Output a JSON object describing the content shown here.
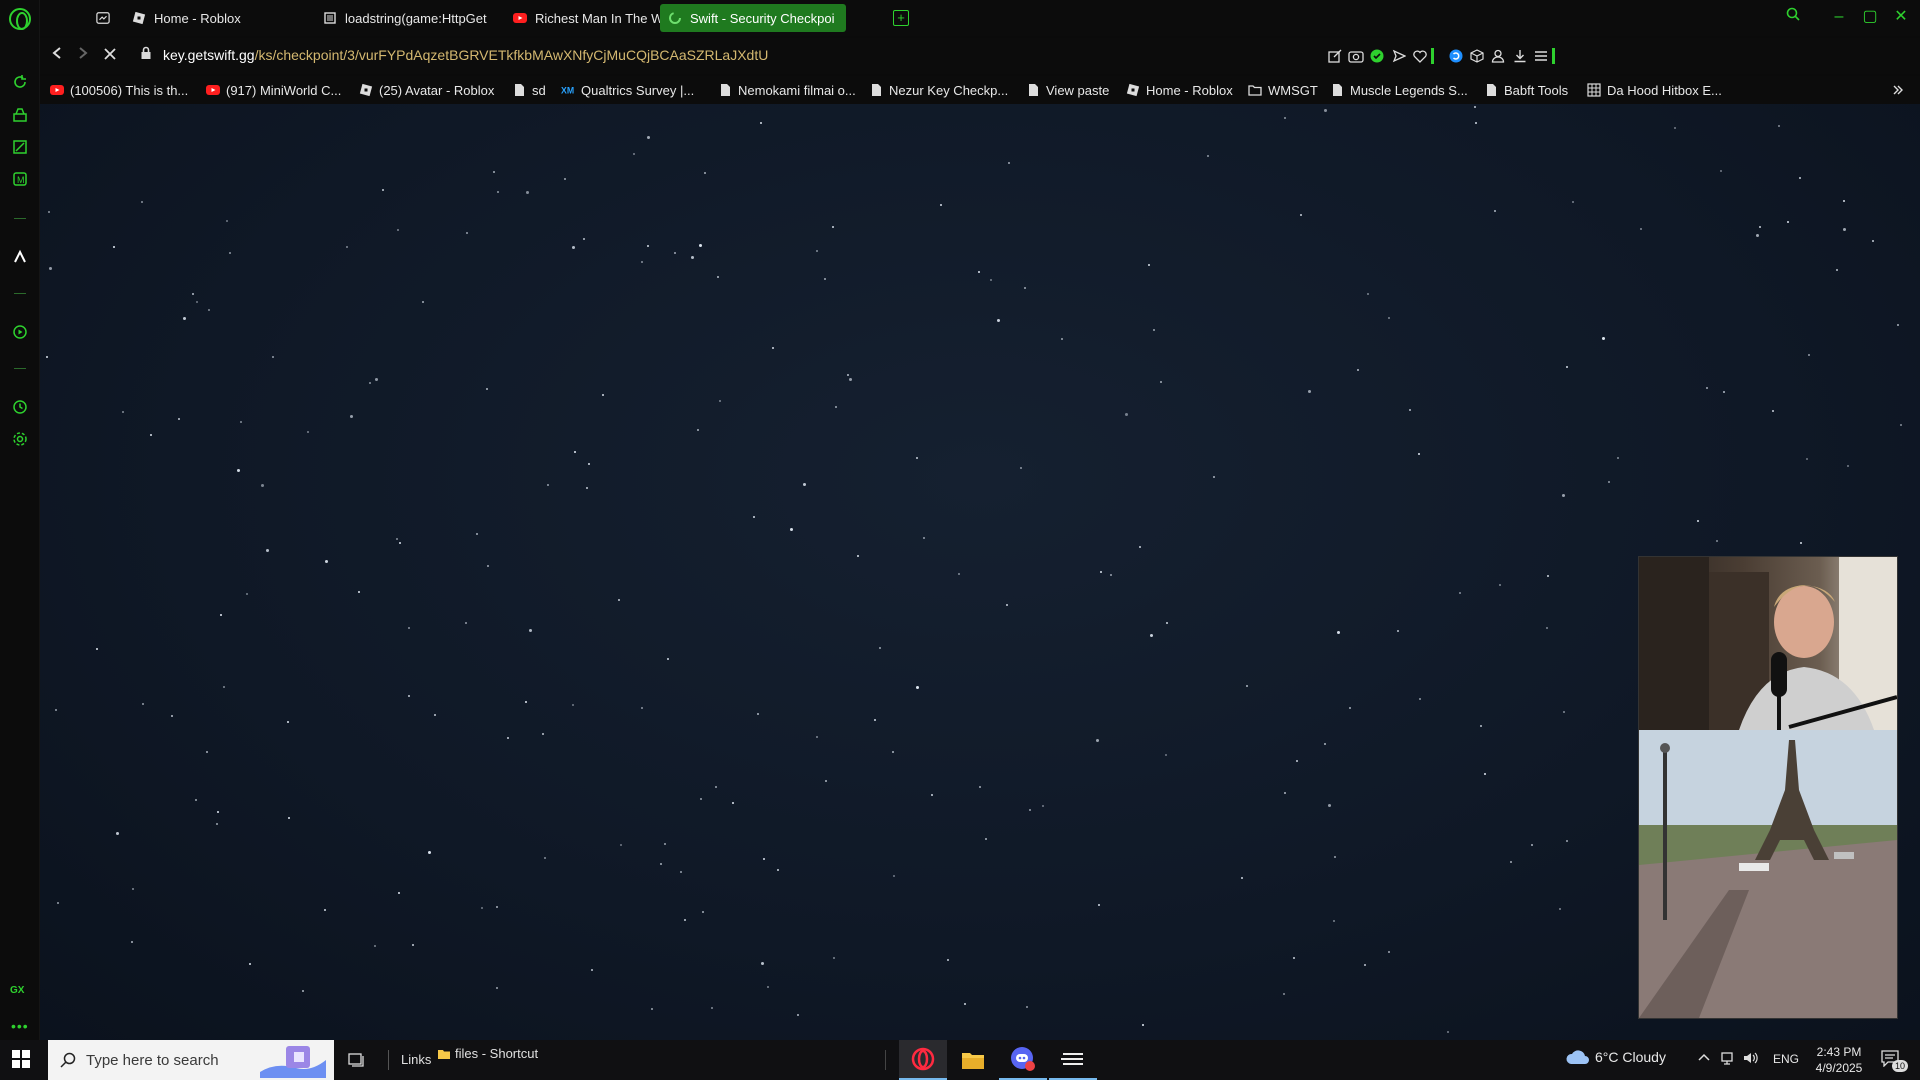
{
  "browser": {
    "tabs": [
      {
        "label": "Home - Roblox",
        "icon": "roblox-icon",
        "active": false
      },
      {
        "label": "loadstring(game:HttpGet(",
        "icon": "page-icon",
        "active": false
      },
      {
        "label": "Richest Man In The World",
        "icon": "youtube-icon",
        "active": false
      },
      {
        "label": "Swift - Security Checkpoi",
        "icon": "loading-icon",
        "active": true
      }
    ],
    "new_tab_label": "+",
    "url_host": "key.getswift.gg",
    "url_path": "/ks/checkpoint/3/vurFYPdAqzetBGRVETkfkbMAwXNfyCjMuCQjBCAaSZRLaJXdtU"
  },
  "bookmarks": [
    {
      "label": "(100506) This is th...",
      "icon": "youtube-icon"
    },
    {
      "label": "(917) MiniWorld C...",
      "icon": "youtube-icon"
    },
    {
      "label": "(25) Avatar - Roblox",
      "icon": "roblox-icon"
    },
    {
      "label": "sd",
      "icon": "page-icon"
    },
    {
      "label": "Qualtrics Survey |...",
      "icon": "qualtrics-icon"
    },
    {
      "label": "Nemokami filmai o...",
      "icon": "page-icon"
    },
    {
      "label": "Nezur Key Checkp...",
      "icon": "page-icon"
    },
    {
      "label": "View paste",
      "icon": "page-icon"
    },
    {
      "label": "Home - Roblox",
      "icon": "roblox-icon"
    },
    {
      "label": "WMSGT",
      "icon": "folder-icon"
    },
    {
      "label": "Muscle Legends S...",
      "icon": "page-icon"
    },
    {
      "label": "Babft Tools",
      "icon": "page-icon"
    },
    {
      "label": "Da Hood Hitbox E...",
      "icon": "grid-icon"
    }
  ],
  "sidebar": {
    "gx_label": "GX",
    "more_label": "•••"
  },
  "taskbar": {
    "search_placeholder": "Type here to search",
    "links_label": "Links",
    "shortcut_label": "files - Shortcut",
    "weather": "6°C  Cloudy",
    "language": "ENG",
    "time": "2:43 PM",
    "date": "4/9/2025",
    "notification_count": "10"
  },
  "colors": {
    "accent": "#2ed12e",
    "active_tab": "#1f7a1f",
    "page_bg": "#0f1826",
    "url_path": "#d4b870"
  }
}
